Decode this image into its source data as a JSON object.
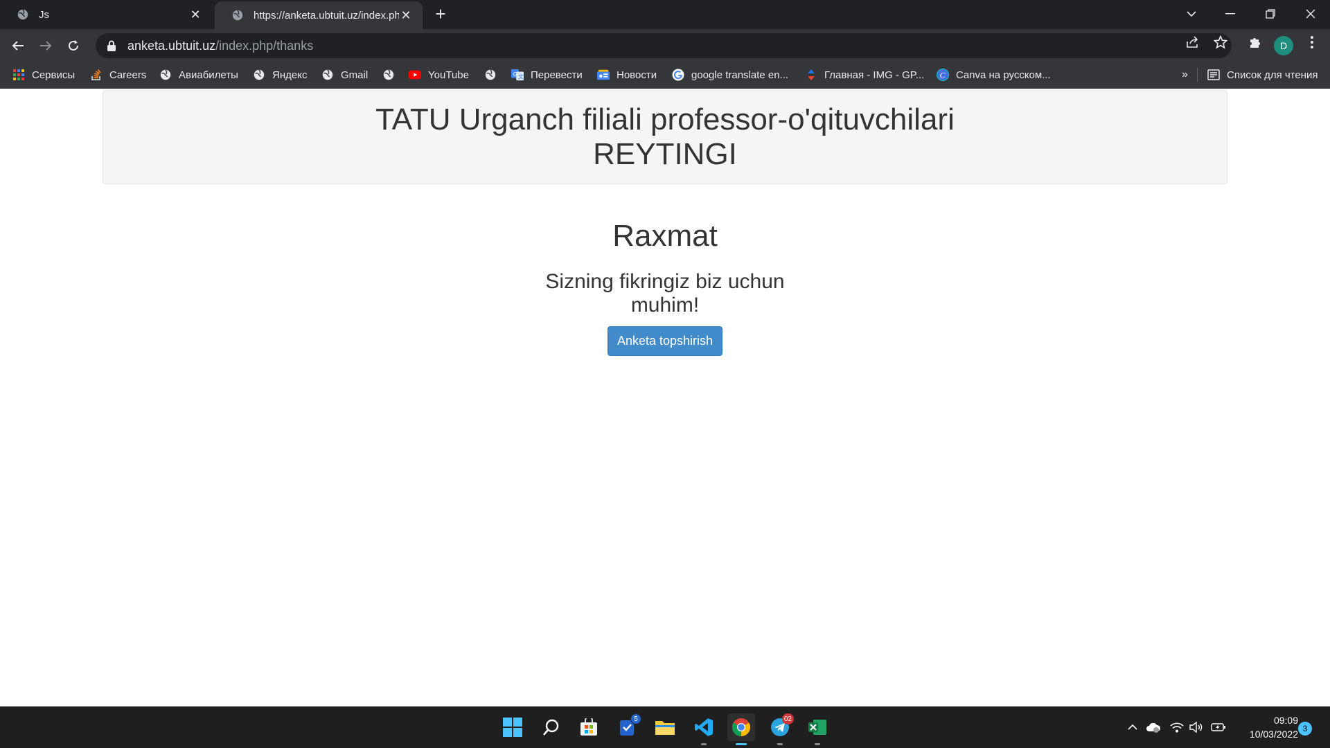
{
  "browser": {
    "tabs": [
      {
        "title": "Js",
        "icon": "globe-icon",
        "active": false
      },
      {
        "title": "https://anketa.ubtuit.uz/index.php",
        "icon": "globe-icon",
        "active": true
      }
    ],
    "address_bar": {
      "domain": "anketa.ubtuit.uz",
      "path": "/index.php/thanks"
    },
    "profile_initial": "D",
    "bookmarks": [
      {
        "label": "Сервисы",
        "icon": "apps-grid-icon"
      },
      {
        "label": "Careers",
        "icon": "stackoverflow-icon"
      },
      {
        "label": "Авиабилеты",
        "icon": "globe-icon"
      },
      {
        "label": "Яндекс",
        "icon": "globe-icon"
      },
      {
        "label": "Gmail",
        "icon": "globe-icon"
      },
      {
        "label": "",
        "icon": "globe-icon"
      },
      {
        "label": "YouTube",
        "icon": "youtube-icon"
      },
      {
        "label": "",
        "icon": "globe-icon"
      },
      {
        "label": "Перевести",
        "icon": "google-translate-icon"
      },
      {
        "label": "Новости",
        "icon": "google-news-icon"
      },
      {
        "label": "google translate en...",
        "icon": "google-icon"
      },
      {
        "label": "Главная - IMG - GP...",
        "icon": "arrows-icon"
      },
      {
        "label": "Canva на русском...",
        "icon": "canva-icon"
      }
    ],
    "overflow_label": "»",
    "reading_list_label": "Список для чтения"
  },
  "page": {
    "header_line1": "TATU Urganch filiali professor-o'qituvchilari",
    "header_line2": "REYTINGI",
    "title": "Raxmat",
    "message": "Sizning fikringiz biz uchun muhim!",
    "button_label": "Anketa topshirish"
  },
  "taskbar": {
    "apps": [
      {
        "name": "start",
        "icon": "windows-start-icon"
      },
      {
        "name": "search",
        "icon": "search-icon"
      },
      {
        "name": "store",
        "icon": "store-icon"
      },
      {
        "name": "todo",
        "icon": "todo-icon",
        "badge": "5"
      },
      {
        "name": "explorer",
        "icon": "folder-icon"
      },
      {
        "name": "vscode",
        "icon": "vscode-icon"
      },
      {
        "name": "chrome",
        "icon": "chrome-icon"
      },
      {
        "name": "telegram",
        "icon": "telegram-icon",
        "badge": "02"
      },
      {
        "name": "excel",
        "icon": "excel-icon"
      }
    ],
    "time": "09:09",
    "date": "10/03/2022",
    "notifications": "3"
  },
  "colors": {
    "primary_button": "#428bca",
    "chrome_dark": "#202124",
    "chrome_toolbar": "#35363a",
    "jumbotron_bg": "#f5f5f5"
  }
}
